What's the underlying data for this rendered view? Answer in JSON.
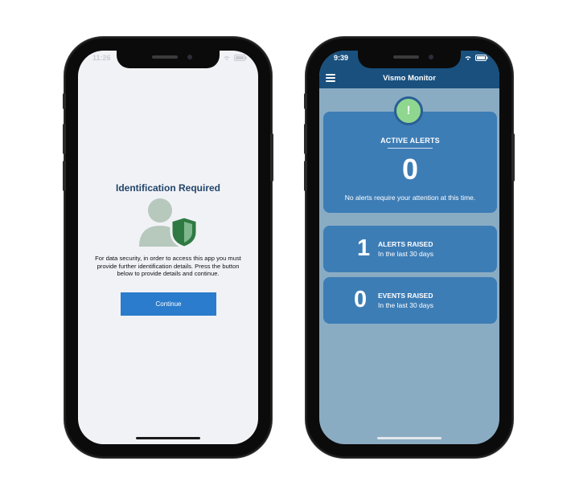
{
  "left_phone": {
    "status_time": "11:26",
    "title": "Identification Required",
    "description": "For data security, in order to access this app you must provide further identification details. Press the button below to provide details and continue.",
    "continue_label": "Continue",
    "colors": {
      "background": "#f1f2f6",
      "title": "#22446a",
      "button": "#2b7ccc",
      "shield": "#2f7a43",
      "person": "#b7c8bc"
    }
  },
  "right_phone": {
    "status_time": "9:39",
    "app_title": "Vismo Monitor",
    "alert_badge_symbol": "!",
    "active_alerts": {
      "title": "ACTIVE ALERTS",
      "count": "0",
      "message": "No alerts require your attention at this time."
    },
    "alerts_raised": {
      "count": "1",
      "title": "ALERTS RAISED",
      "subtitle": "In the last 30 days"
    },
    "events_raised": {
      "count": "0",
      "title": "EVENTS RAISED",
      "subtitle": "In the last 30 days"
    },
    "colors": {
      "header": "#19507e",
      "background": "#8aacc3",
      "card": "#3d7db6",
      "badge": "#8fd78f"
    }
  }
}
